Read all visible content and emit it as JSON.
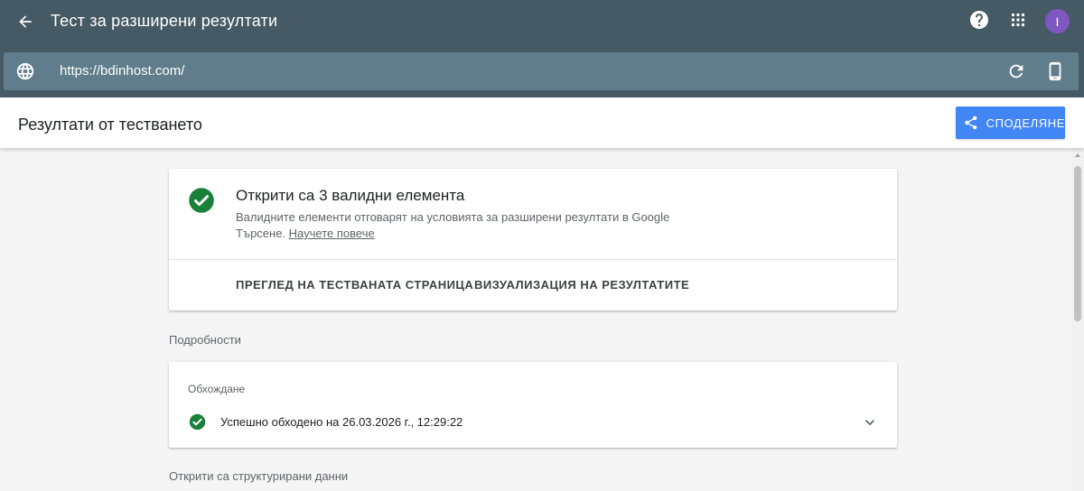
{
  "app": {
    "title": "Тест за разширени резултати",
    "avatar_letter": "I"
  },
  "urlbar": {
    "url": "https://bdinhost.com/"
  },
  "header": {
    "page_title": "Резултати от тестването",
    "share_label": "СПОДЕЛЯНЕ"
  },
  "summary": {
    "title": "Открити са 3 валидни елемента",
    "description": "Валидните елементи отговарят на условията за разширени резултати в Google Търсене.",
    "learn_more": "Научете повече",
    "actions": {
      "view_tested_page": "ПРЕГЛЕД НА ТЕСТВАНАТА СТРАНИЦА",
      "preview_results": "ВИЗУАЛИЗАЦИЯ НА РЕЗУЛТАТИТЕ"
    }
  },
  "details": {
    "section_label": "Подробности",
    "crawl": {
      "label": "Обхождане",
      "status": "Успешно обходено на 26.03.2026 г., 12:29:22"
    }
  },
  "structured": {
    "section_label": "Открити са структурирани данни"
  },
  "colors": {
    "topbar": "#455a64",
    "urlbar": "#607d8b",
    "accent": "#4285f4",
    "success": "#188038",
    "avatar": "#7e57c2"
  },
  "icons": {
    "back": "arrow-left-icon",
    "help": "help-circle-icon",
    "apps": "apps-grid-icon",
    "globe": "globe-icon",
    "reload": "reload-icon",
    "device": "smartphone-icon",
    "share": "share-icon",
    "valid": "check-circle-icon",
    "expand": "chevron-down-icon"
  }
}
